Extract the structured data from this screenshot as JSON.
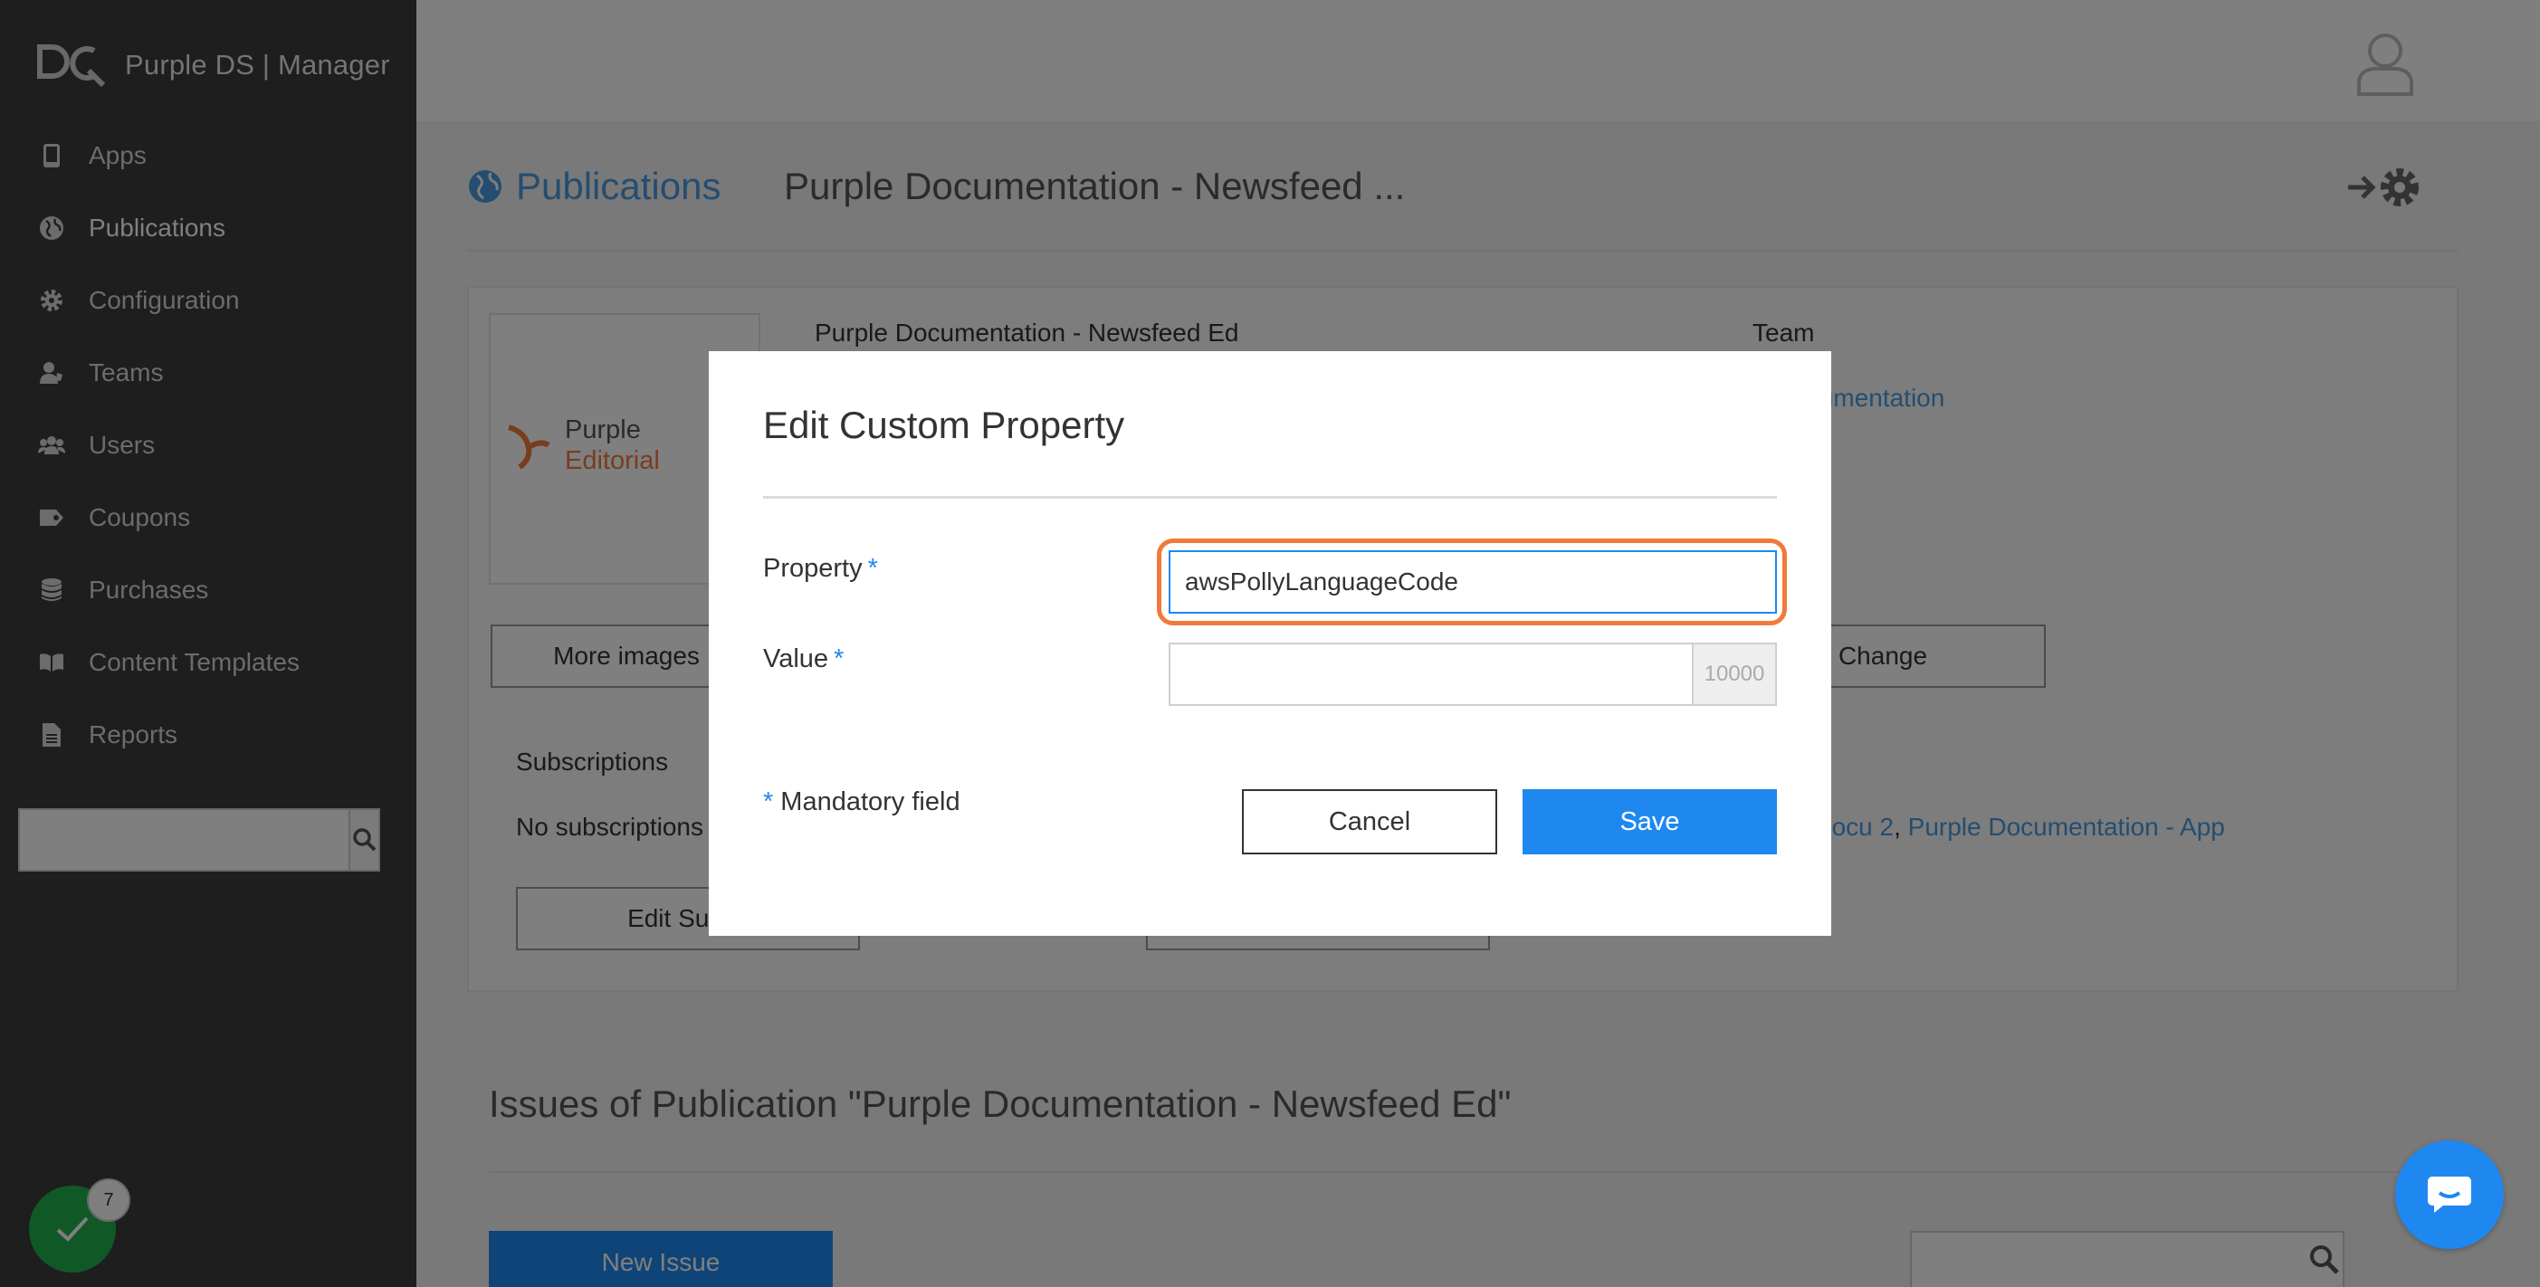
{
  "app": {
    "brand_title": "Purple DS | Manager"
  },
  "sidebar": {
    "items": [
      {
        "label": "Apps",
        "icon": "mobile-icon"
      },
      {
        "label": "Publications",
        "icon": "globe-icon"
      },
      {
        "label": "Configuration",
        "icon": "gear-icon"
      },
      {
        "label": "Teams",
        "icon": "team-icon"
      },
      {
        "label": "Users",
        "icon": "users-icon"
      },
      {
        "label": "Coupons",
        "icon": "tag-icon"
      },
      {
        "label": "Purchases",
        "icon": "database-icon"
      },
      {
        "label": "Content Templates",
        "icon": "book-icon"
      },
      {
        "label": "Reports",
        "icon": "document-icon"
      }
    ],
    "search": {
      "placeholder": ""
    }
  },
  "notifications": {
    "count": "7"
  },
  "header": {
    "breadcrumb_section": "Publications",
    "publication_title": "Purple Documentation - Newsfeed ..."
  },
  "publication": {
    "name": "Purple Documentation - Newsfeed Ed",
    "cover_brand_line1": "Purple",
    "cover_brand_line2": "Editorial",
    "team_label": "Team",
    "team_link": "Documentation",
    "more_images_label": "More images",
    "change_label": "Change",
    "subscriptions_label": "Subscriptions",
    "subscriptions_empty": "No subscriptions",
    "edit_subscriptions_label": "Edit Subsc",
    "apps_links": [
      "e Docu 2",
      "Purple Documentation - App"
    ],
    "apps_separator": ", "
  },
  "issues": {
    "title": "Issues of Publication \"Purple Documentation - Newsfeed Ed\"",
    "new_issue_label": "New Issue"
  },
  "modal": {
    "title": "Edit Custom Property",
    "property_label": "Property",
    "property_value": "awsPollyLanguageCode",
    "value_label": "Value",
    "value_value": "",
    "value_counter": "10000",
    "required_marker": "*",
    "mandatory_note": "Mandatory field",
    "cancel_label": "Cancel",
    "save_label": "Save"
  },
  "colors": {
    "accent": "#1f88f0",
    "focus_ring": "#f07a3c",
    "sidebar_bg": "#3c3c3c",
    "success": "#21b24f"
  }
}
